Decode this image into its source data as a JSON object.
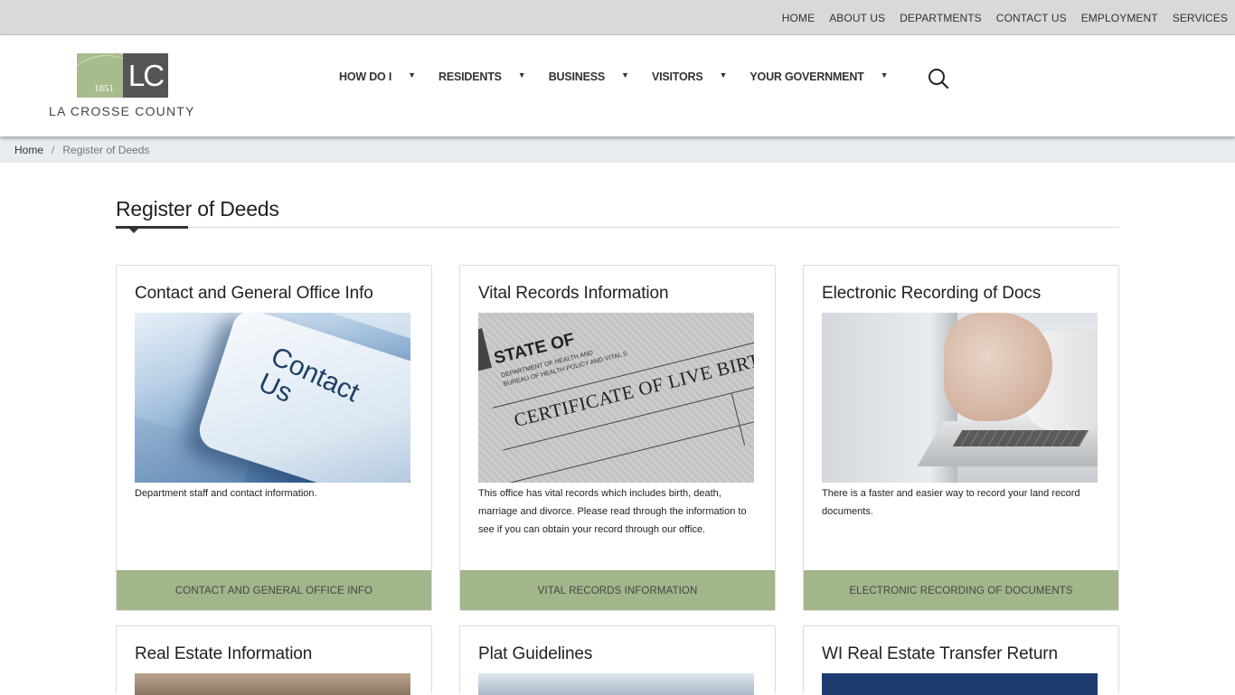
{
  "utility_nav": [
    "HOME",
    "ABOUT US",
    "DEPARTMENTS",
    "CONTACT US",
    "EMPLOYMENT",
    "SERVICES"
  ],
  "logo": {
    "initials": "LC",
    "year": "1851",
    "name": "LA CROSSE COUNTY",
    "brand_green": "#a7bb8d",
    "brand_gray": "#555555"
  },
  "main_nav": [
    "HOW DO I",
    "RESIDENTS",
    "BUSINESS",
    "VISITORS",
    "YOUR GOVERNMENT"
  ],
  "icons": {
    "dropdown": "caret-down-icon",
    "search": "search-icon"
  },
  "breadcrumb": {
    "home": "Home",
    "separator": "/",
    "current": "Register of Deeds"
  },
  "page": {
    "title": "Register of Deeds"
  },
  "cards": [
    {
      "title": "Contact and General Office Info",
      "image_alt": "Contact Us",
      "image_text": "Contact Us",
      "description": "Department staff and contact information.",
      "button": "CONTACT AND GENERAL OFFICE INFO"
    },
    {
      "title": "Vital Records Information",
      "image_alt": "Certificate of live birth",
      "image_lines": [
        "STATE OF",
        "DEPARTMENT OF HEALTH AND",
        "BUREAU OF HEALTH POLICY AND VITAL S",
        "CERTIFICATE OF LIVE BIRTH"
      ],
      "description": "This office has vital records which includes birth, death, marriage and divorce.  Please read through the information to see if you can obtain your record through our office.",
      "button": "VITAL RECORDS INFORMATION"
    },
    {
      "title": "Electronic Recording of Docs",
      "image_alt": "Hand typing on laptop",
      "description": "There is a faster and easier way to record your land record documents.",
      "button": "ELECTRONIC RECORDING OF DOCUMENTS"
    },
    {
      "title": "Real Estate Information"
    },
    {
      "title": "Plat Guidelines"
    },
    {
      "title": "WI Real Estate Transfer Return"
    }
  ],
  "colors": {
    "card_button_bg": "#a3b68b",
    "utility_bg": "#d9d9d9",
    "breadcrumb_bg": "#e9ecef"
  }
}
